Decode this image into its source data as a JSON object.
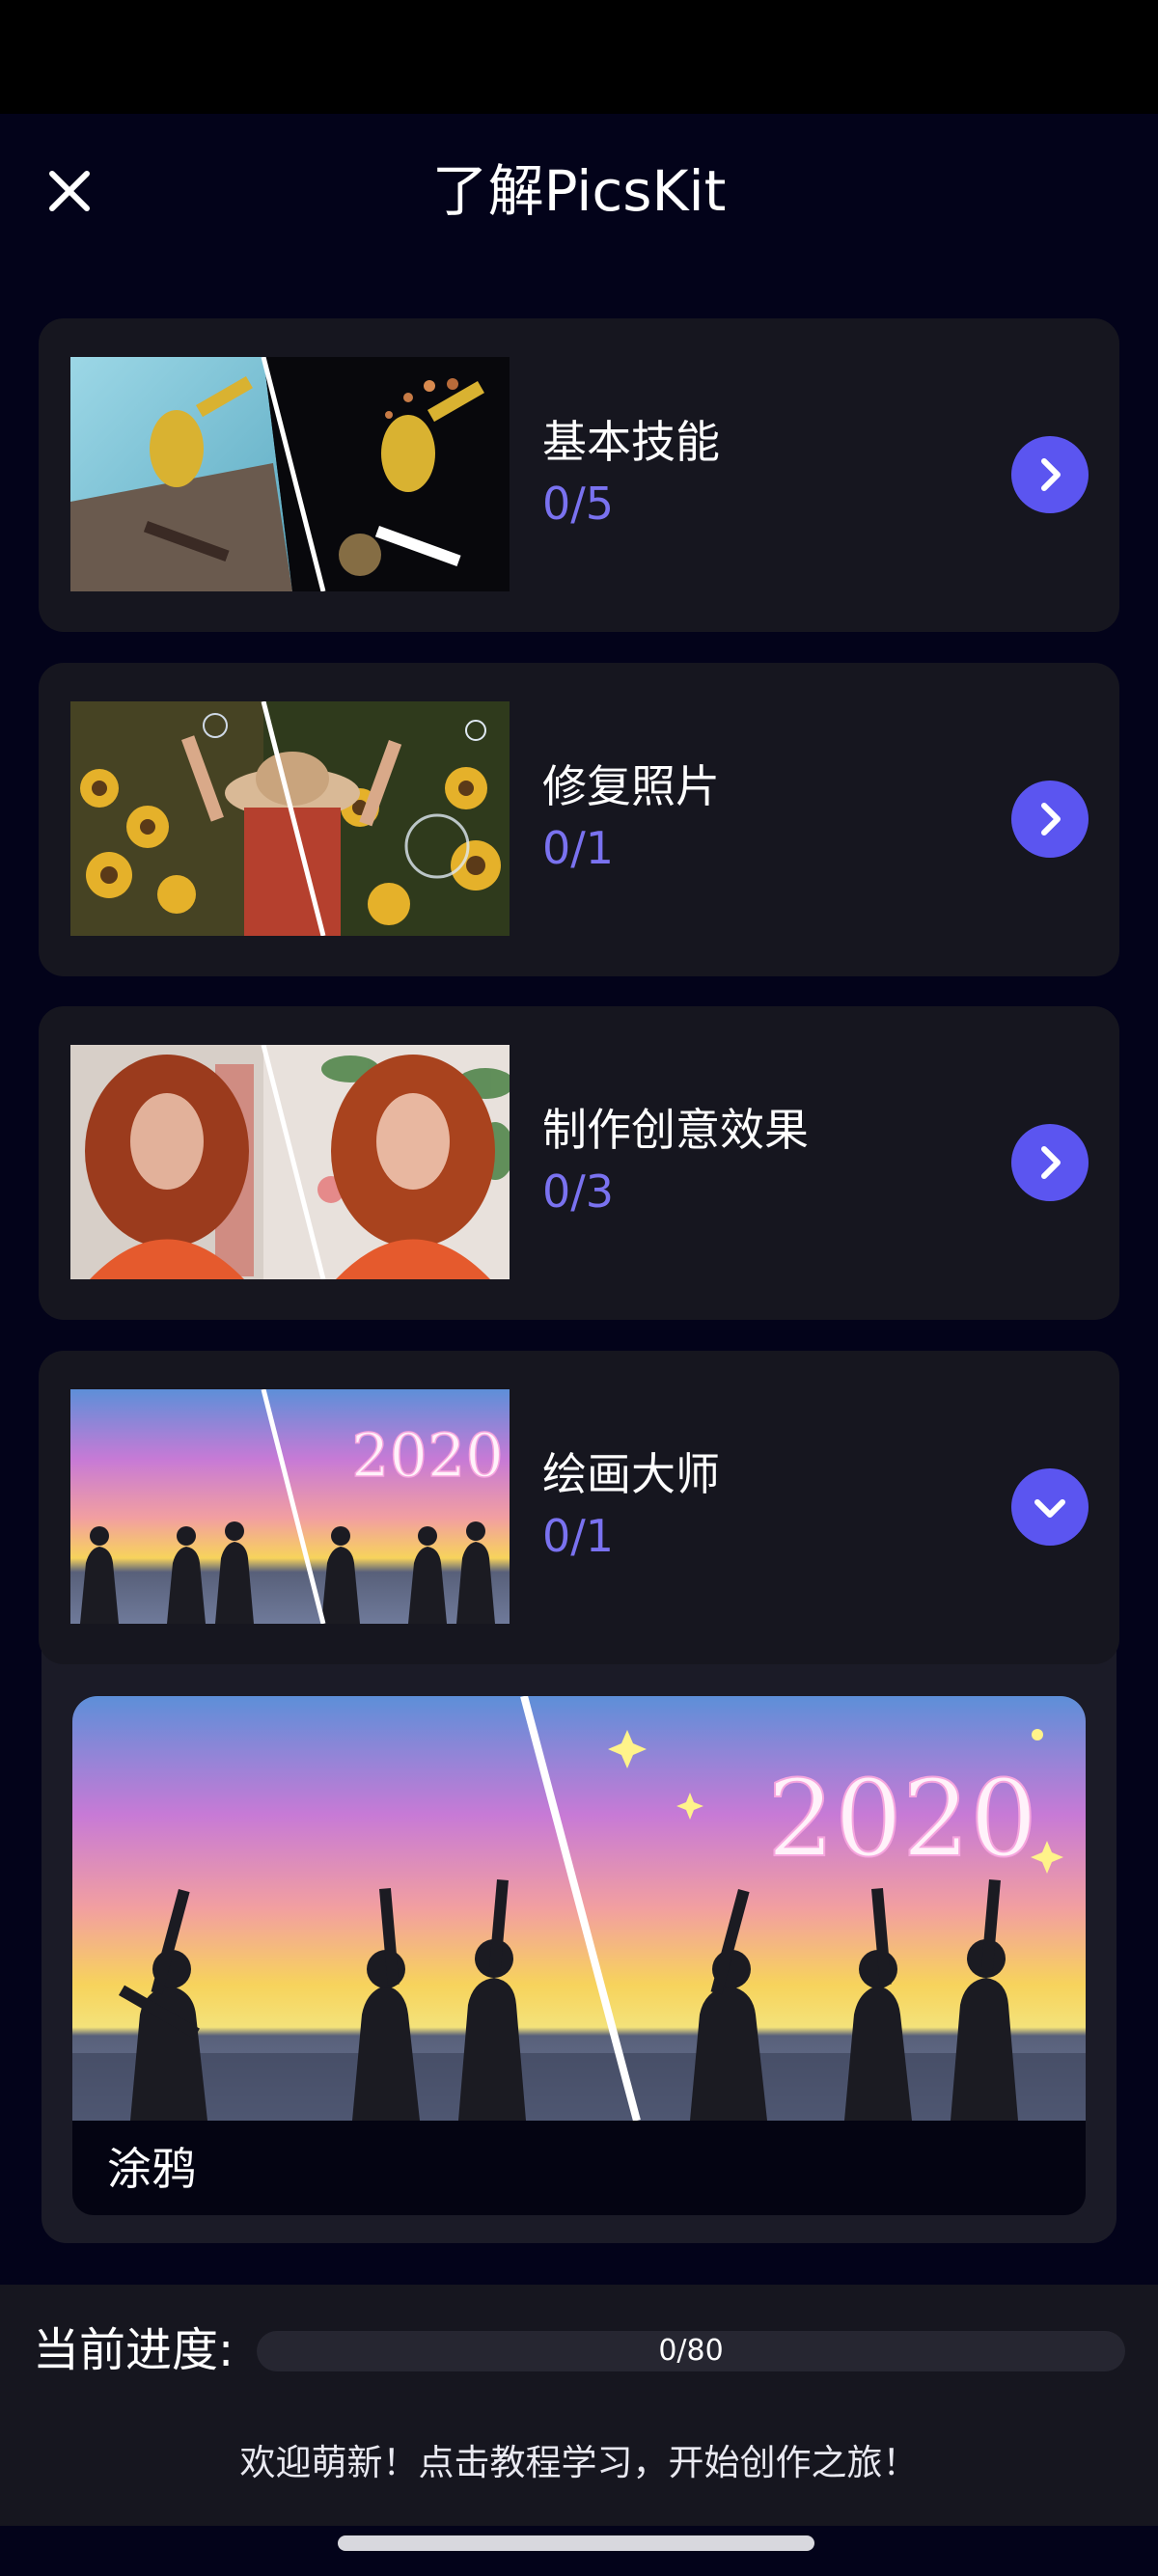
{
  "app": {
    "title": "了解PicsKit"
  },
  "icons": {
    "close": "close-icon",
    "arrow": "chevron-right-icon",
    "expanded": "chevron-down-icon"
  },
  "colors": {
    "accent": "#5b55f0",
    "progress_text": "#7a72f0",
    "card_bg": "#16161f",
    "page_bg": "#03031a"
  },
  "lessons": [
    {
      "title": "基本技能",
      "progress": "0/5"
    },
    {
      "title": "修复照片",
      "progress": "0/1"
    },
    {
      "title": "制作创意效果",
      "progress": "0/3"
    },
    {
      "title": "绘画大师",
      "progress": "0/1",
      "expanded": true
    }
  ],
  "expanded_section": {
    "item_label": "涂鸦",
    "overlay_text": "2020"
  },
  "footer": {
    "progress_label": "当前进度:",
    "progress_text": "0/80",
    "progress_fraction": 0,
    "welcome": "欢迎萌新！点击教程学习，开始创作之旅！"
  }
}
